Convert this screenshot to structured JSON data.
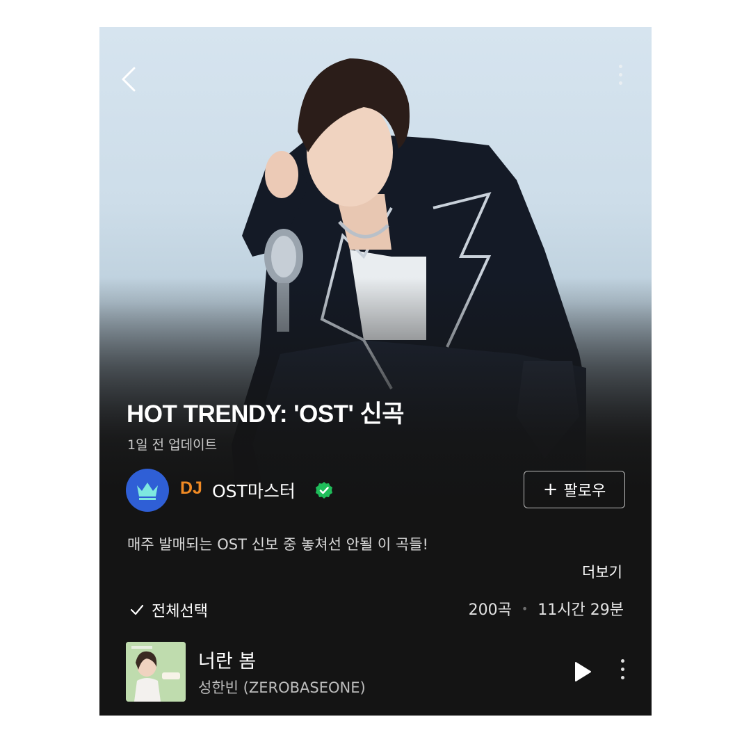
{
  "header": {
    "back_icon": "chevron-left-icon",
    "more_icon": "more-vertical-icon"
  },
  "playlist": {
    "title": "HOT TRENDY: 'OST' 신곡",
    "updated": "1일 전 업데이트",
    "description": "매주 발매되는 OST 신보 중 놓쳐선 안될 이 곡들!",
    "more_label": "더보기"
  },
  "dj": {
    "badge": "DJ",
    "name": "OST마스터",
    "avatar_icon": "crown-icon",
    "verified_icon": "verified-check-icon",
    "follow_label": "팔로우",
    "follow_icon": "plus-icon"
  },
  "list_header": {
    "select_all_label": "전체선택",
    "track_count": "200곡",
    "duration": "11시간 29분"
  },
  "tracks": [
    {
      "title": "너란 봄",
      "artist": "성한빈 (ZEROBASEONE)"
    }
  ],
  "colors": {
    "background": "#141414",
    "dj_badge": "#f08a24",
    "avatar": "#2f5fd6",
    "verified": "#1fbd5a"
  }
}
